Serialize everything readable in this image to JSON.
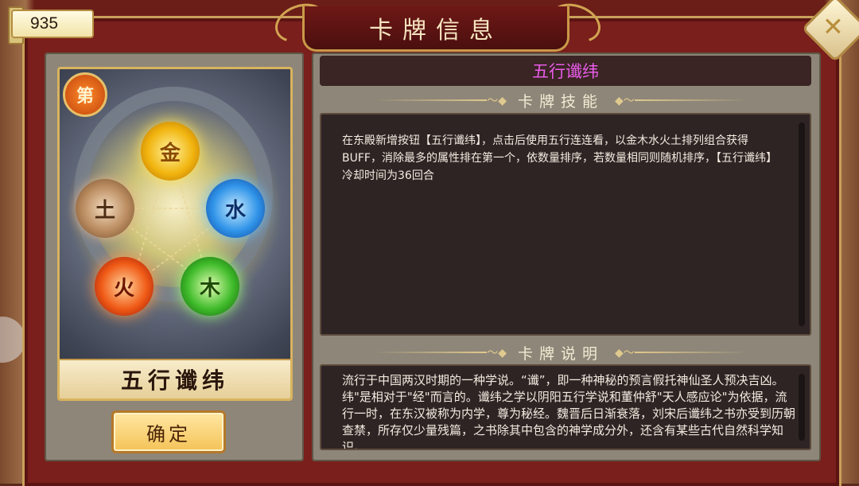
{
  "header": {
    "title": "卡牌信息"
  },
  "currency": {
    "value": "935"
  },
  "card": {
    "badge": "第",
    "name": "五行谶纬",
    "elements": {
      "gold": "金",
      "water": "水",
      "wood": "木",
      "fire": "火",
      "earth": "土"
    }
  },
  "confirm_label": "确定",
  "skill": {
    "title": "五行谶纬",
    "section_skill": "卡牌技能",
    "skill_text": "在东殿新增按钮【五行谶纬】，点击后使用五行连连看，以金木水火土排列组合获得BUFF，消除最多的属性排在第一个，依数量排序，若数量相同则随机排序，【五行谶纬】冷却时间为36回合",
    "section_desc": "卡牌说明",
    "desc_text": "流行于中国两汉时期的一种学说。“谶”，即一种神秘的预言假托神仙圣人预决吉凶。纬\"是相对于\"经\"而言的。谶纬之学以阴阳五行学说和董仲舒\"天人感应论\"为依据，流行一时，在东汉被称为内学，尊为秘经。魏晋后日渐衰落，刘宋后谶纬之书亦受到历朝查禁，所存仅少量残篇，之书除其中包含的神学成分外，还含有某些古代自然科学知识。"
  },
  "colors": {
    "skill_title": "#e95ce9",
    "frame": "#7a1f1c",
    "gold_trim": "#c9a15a"
  },
  "icons": {
    "close": "close-icon",
    "swirl": "swirl-ornament-icon"
  }
}
